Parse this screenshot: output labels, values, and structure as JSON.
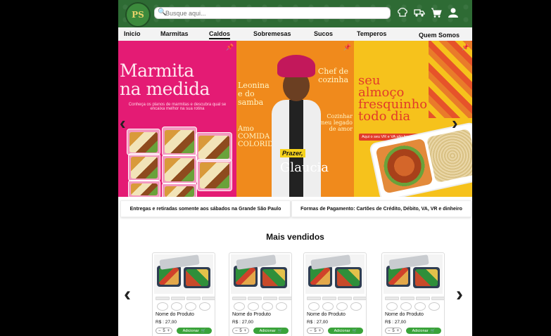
{
  "header": {
    "logo_text": "PS",
    "search_placeholder": "Busque aqui...",
    "icons": [
      "chef-hat-icon",
      "delivery-icon",
      "cart-icon",
      "user-icon"
    ]
  },
  "nav": {
    "items": [
      "Inicio",
      "Marmitas",
      "Caldos",
      "Sobremesas",
      "Sucos",
      "Temperos",
      "Quem Somos"
    ],
    "active": "Caldos"
  },
  "banners": {
    "b1": {
      "title_line1": "Marmita",
      "title_line2": "na medida",
      "subtitle": "Conheça os planos de marmitas e descubra qual se encaixa melhor na sua rotina"
    },
    "b2": {
      "text_left": "Leonina\ne do\nsamba",
      "text_right": "Chef de\ncozinha",
      "text_left2": "Amo\nCOMIDA\nCOLORIDA",
      "text_right2": "Cozinhar\né meu legado\nde amor",
      "greeting": "Prazer,",
      "name": "Glaucia"
    },
    "b3": {
      "title": "seu\nalmoço\nfresquinho\ntodo dia",
      "pill": "Aqui o seu VR e VA são bem vindos"
    }
  },
  "info": {
    "delivery": "Entregas e retiradas somente aos sábados na Grande São Paulo",
    "payment": "Formas de Pagamento: Cartões de Crédito, Débito, VA, VR e dinheiro"
  },
  "bestsellers": {
    "heading": "Mais vendidos",
    "products": [
      {
        "name": "Nome do Produto",
        "price": "R$ : 27,00",
        "qty": "5",
        "add_label": "Adicionar"
      },
      {
        "name": "Nome do Produto",
        "price": "R$ : 27,00",
        "qty": "5",
        "add_label": "Adicionar"
      },
      {
        "name": "Nome do Produto",
        "price": "R$ : 27,00",
        "qty": "5",
        "add_label": "Adicionar"
      },
      {
        "name": "Nome do Produto",
        "price": "R$ : 27,00",
        "qty": "5",
        "add_label": "Adicionar"
      }
    ]
  },
  "colors": {
    "header_green": "#2e6b34",
    "banner_pink": "#e41b74",
    "banner_orange": "#f08a1c",
    "banner_yellow": "#f6c21c",
    "button_green": "#3aa33a"
  }
}
